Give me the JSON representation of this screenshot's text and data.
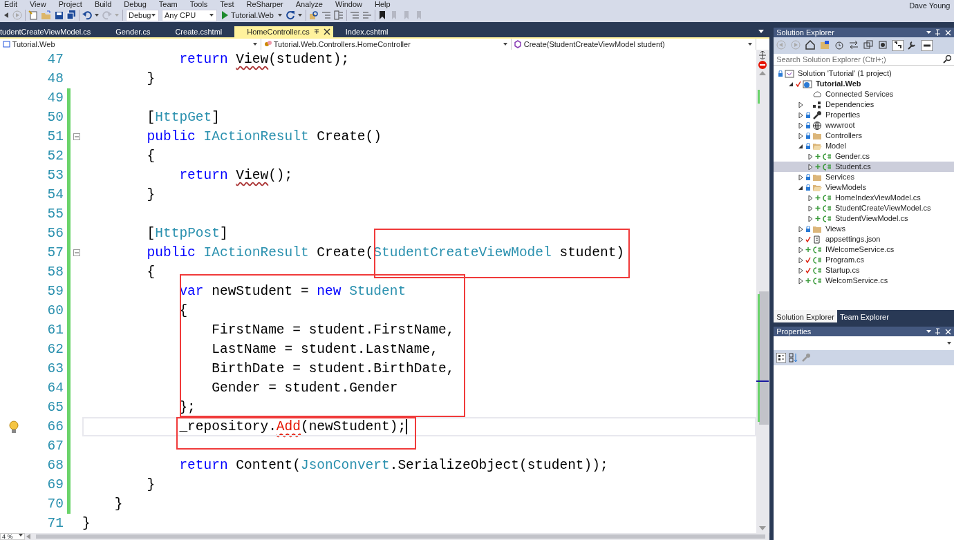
{
  "menu": [
    "Edit",
    "View",
    "Project",
    "Build",
    "Debug",
    "Team",
    "Tools",
    "Test",
    "ReSharper",
    "Analyze",
    "Window",
    "Help"
  ],
  "user": "Dave Young",
  "toolbar": {
    "configuration": "Debug",
    "platform": "Any CPU",
    "start_target": "Tutorial.Web"
  },
  "tabs": [
    {
      "label": "tudentCreateViewModel.cs",
      "selected": false
    },
    {
      "label": "Gender.cs",
      "selected": false
    },
    {
      "label": "Create.cshtml",
      "selected": false
    },
    {
      "label": "HomeController.cs",
      "selected": true
    },
    {
      "label": "Index.cshtml",
      "selected": false
    }
  ],
  "navigation": [
    "Tutorial.Web",
    "Tutorial.Web.Controllers.HomeController",
    "Create(StudentCreateViewModel student)"
  ],
  "code_lines": [
    {
      "number": "47",
      "changed": false,
      "current": false,
      "tokens": [
        {
          "text": "            return ",
          "kind": "keyword"
        },
        {
          "text": "View",
          "kind": "squiggle"
        },
        {
          "text": "(student);",
          "kind": "plain"
        }
      ]
    },
    {
      "number": "48",
      "changed": false,
      "current": false,
      "tokens": [
        {
          "text": "        }",
          "kind": "plain"
        }
      ]
    },
    {
      "number": "49",
      "changed": true,
      "current": false
    },
    {
      "number": "50",
      "changed": true,
      "current": false,
      "tokens": [
        {
          "text": "        [",
          "kind": "plain"
        },
        {
          "text": "HttpGet",
          "kind": "type"
        },
        {
          "text": "]",
          "kind": "plain"
        }
      ]
    },
    {
      "number": "51",
      "changed": true,
      "current": false,
      "collapsible": true,
      "tokens": [
        {
          "text": "        public ",
          "kind": "keyword"
        },
        {
          "text": "IActionResult",
          "kind": "type"
        },
        {
          "text": " Create()",
          "kind": "plain"
        }
      ]
    },
    {
      "number": "52",
      "changed": true,
      "current": false,
      "tokens": [
        {
          "text": "        {",
          "kind": "plain"
        }
      ]
    },
    {
      "number": "53",
      "changed": true,
      "current": false,
      "tokens": [
        {
          "text": "            return ",
          "kind": "keyword"
        },
        {
          "text": "View",
          "kind": "squiggle"
        },
        {
          "text": "();",
          "kind": "plain"
        }
      ]
    },
    {
      "number": "54",
      "changed": true,
      "current": false,
      "tokens": [
        {
          "text": "        }",
          "kind": "plain"
        }
      ]
    },
    {
      "number": "55",
      "changed": true,
      "current": false
    },
    {
      "number": "56",
      "changed": true,
      "current": false,
      "tokens": [
        {
          "text": "        [",
          "kind": "plain"
        },
        {
          "text": "HttpPost",
          "kind": "type"
        },
        {
          "text": "]",
          "kind": "plain"
        }
      ]
    },
    {
      "number": "57",
      "changed": true,
      "current": false,
      "collapsible": true,
      "tokens": [
        {
          "text": "        public ",
          "kind": "keyword"
        },
        {
          "text": "IActionResult",
          "kind": "type"
        },
        {
          "text": " Create(",
          "kind": "plain"
        },
        {
          "text": "StudentCreateViewModel",
          "kind": "type"
        },
        {
          "text": " student)",
          "kind": "plain"
        }
      ]
    },
    {
      "number": "58",
      "changed": true,
      "current": false,
      "tokens": [
        {
          "text": "        {",
          "kind": "plain"
        }
      ]
    },
    {
      "number": "59",
      "changed": true,
      "current": false,
      "tokens": [
        {
          "text": "            var",
          "kind": "keyword"
        },
        {
          "text": " newStudent = ",
          "kind": "plain"
        },
        {
          "text": "new ",
          "kind": "keyword"
        },
        {
          "text": "Student",
          "kind": "type"
        }
      ]
    },
    {
      "number": "60",
      "changed": true,
      "current": false,
      "tokens": [
        {
          "text": "            {",
          "kind": "plain"
        }
      ]
    },
    {
      "number": "61",
      "changed": true,
      "current": false,
      "tokens": [
        {
          "text": "                FirstName = student.FirstName,",
          "kind": "plain"
        }
      ]
    },
    {
      "number": "62",
      "changed": true,
      "current": false,
      "tokens": [
        {
          "text": "                LastName = student.LastName,",
          "kind": "plain"
        }
      ]
    },
    {
      "number": "63",
      "changed": true,
      "current": false,
      "tokens": [
        {
          "text": "                BirthDate = student.BirthDate,",
          "kind": "plain"
        }
      ]
    },
    {
      "number": "64",
      "changed": true,
      "current": false,
      "tokens": [
        {
          "text": "                Gender = student.Gender",
          "kind": "plain"
        }
      ]
    },
    {
      "number": "65",
      "changed": true,
      "current": false,
      "tokens": [
        {
          "text": "            };",
          "kind": "plain"
        }
      ]
    },
    {
      "number": "66",
      "changed": true,
      "current": true,
      "tokens": [
        {
          "text": "            _repository.",
          "kind": "plain"
        },
        {
          "text": "Add",
          "kind": "error"
        },
        {
          "text": "(newStudent);",
          "kind": "plain"
        }
      ]
    },
    {
      "number": "67",
      "changed": true,
      "current": false
    },
    {
      "number": "68",
      "changed": true,
      "current": false,
      "tokens": [
        {
          "text": "            return",
          "kind": "keyword"
        },
        {
          "text": " Content(",
          "kind": "plain"
        },
        {
          "text": "JsonConvert",
          "kind": "type"
        },
        {
          "text": ".SerializeObject(student));",
          "kind": "plain"
        }
      ]
    },
    {
      "number": "69",
      "changed": true,
      "current": false,
      "tokens": [
        {
          "text": "        }",
          "kind": "plain"
        }
      ]
    },
    {
      "number": "70",
      "changed": true,
      "current": false,
      "tokens": [
        {
          "text": "    }",
          "kind": "plain"
        }
      ]
    },
    {
      "number": "71",
      "changed": false,
      "current": false,
      "tokens": [
        {
          "text": "}",
          "kind": "plain"
        }
      ]
    }
  ],
  "annotation_boxes": [
    {
      "kind": "rectangle"
    },
    {
      "kind": "rectangle"
    },
    {
      "kind": "rectangle"
    }
  ],
  "zoom": "4 %",
  "solution_explorer": {
    "title": "Solution Explorer",
    "search": {
      "placeholder": "Search Solution Explorer (Ctrl+;)"
    },
    "tree": [
      {
        "label": "Solution 'Tutorial' (1 project)",
        "kind": "solution",
        "badge": {
          "kind": "lock"
        },
        "selected": false,
        "children": [
          {
            "label": "Tutorial.Web",
            "kind": "project",
            "badge": {
              "kind": "edited"
            },
            "expanded": true,
            "selected": false,
            "children": [
              {
                "label": "Connected Services",
                "kind": "cloud",
                "selected": false
              },
              {
                "label": "Dependencies",
                "kind": "dependencies",
                "expanded": false,
                "selected": false
              },
              {
                "label": "Properties",
                "kind": "wrench",
                "badge": {
                  "kind": "lock"
                },
                "expanded": false,
                "selected": false
              },
              {
                "label": "wwwroot",
                "kind": "globe",
                "badge": {
                  "kind": "lock"
                },
                "expanded": false,
                "selected": false
              },
              {
                "label": "Controllers",
                "kind": "folder",
                "badge": {
                  "kind": "lock"
                },
                "expanded": false,
                "selected": false
              },
              {
                "label": "Model",
                "kind": "folder",
                "badge": {
                  "kind": "lock"
                },
                "expanded": true,
                "selected": false,
                "children": [
                  {
                    "label": "Gender.cs",
                    "kind": "csharp",
                    "badge": {
                      "kind": "added"
                    },
                    "expanded": false,
                    "selected": false
                  },
                  {
                    "label": "Student.cs",
                    "kind": "csharp",
                    "badge": {
                      "kind": "added"
                    },
                    "expanded": false,
                    "selected": true
                  }
                ]
              },
              {
                "label": "Services",
                "kind": "folder",
                "badge": {
                  "kind": "lock"
                },
                "expanded": false,
                "selected": false
              },
              {
                "label": "ViewModels",
                "kind": "folder",
                "badge": {
                  "kind": "lock"
                },
                "expanded": true,
                "selected": false,
                "children": [
                  {
                    "label": "HomeIndexViewModel.cs",
                    "kind": "csharp",
                    "badge": {
                      "kind": "added"
                    },
                    "expanded": false,
                    "selected": false
                  },
                  {
                    "label": "StudentCreateViewModel.cs",
                    "kind": "csharp",
                    "badge": {
                      "kind": "added"
                    },
                    "expanded": false,
                    "selected": false
                  },
                  {
                    "label": "StudentViewModel.cs",
                    "kind": "csharp",
                    "badge": {
                      "kind": "added"
                    },
                    "expanded": false,
                    "selected": false
                  }
                ]
              },
              {
                "label": "Views",
                "kind": "folder",
                "badge": {
                  "kind": "lock"
                },
                "expanded": false,
                "selected": false
              },
              {
                "label": "appsettings.json",
                "kind": "json",
                "badge": {
                  "kind": "edited"
                },
                "expanded": false,
                "selected": false
              },
              {
                "label": "IWelcomeService.cs",
                "kind": "csharp",
                "badge": {
                  "kind": "added"
                },
                "expanded": false,
                "selected": false
              },
              {
                "label": "Program.cs",
                "kind": "csharp",
                "badge": {
                  "kind": "edited"
                },
                "expanded": false,
                "selected": false
              },
              {
                "label": "Startup.cs",
                "kind": "csharp",
                "badge": {
                  "kind": "edited"
                },
                "expanded": false,
                "selected": false
              },
              {
                "label": "WelcomService.cs",
                "kind": "csharp",
                "badge": {
                  "kind": "added"
                },
                "expanded": false,
                "selected": false
              }
            ]
          }
        ]
      }
    ],
    "tabs": [
      {
        "label": "Solution Explorer",
        "selected": true
      },
      {
        "label": "Team Explorer",
        "selected": false
      }
    ]
  },
  "properties": {
    "title": "Properties"
  }
}
